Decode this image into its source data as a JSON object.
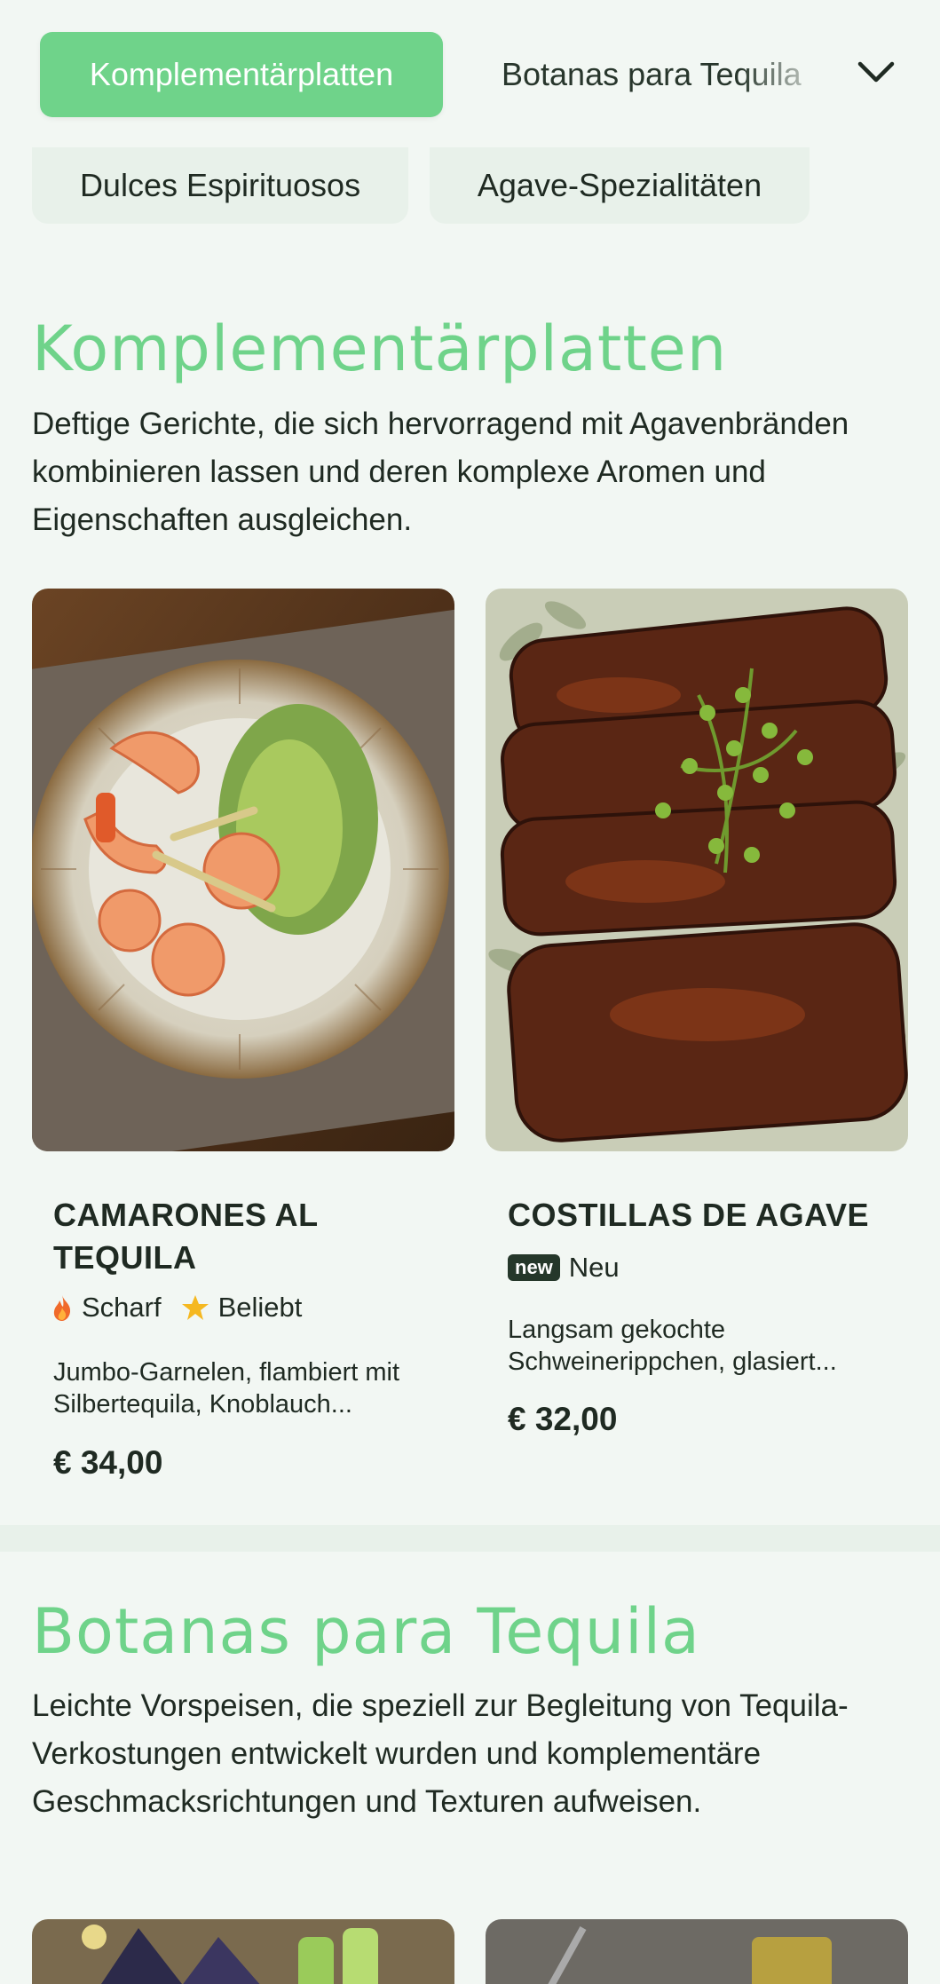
{
  "nav": {
    "active": "Komplementärplatten",
    "next": "Botanas para Tequila",
    "row2": [
      "Dulces Espirituosos",
      "Agave-Spezialitäten"
    ],
    "toggle_icon": "chevron-down-icon"
  },
  "sections": [
    {
      "title": "Komplementärplatten",
      "description": "Deftige Gerichte, die sich hervorragend mit Agavenbränden kombinieren lassen und deren komplexe Aromen und Eigenschaften ausgleichen.",
      "items": [
        {
          "name": "CAMARONES AL TEQUILA",
          "tags": [
            {
              "icon": "fire-icon",
              "label": "Scharf"
            },
            {
              "icon": "star-icon",
              "label": "Beliebt"
            }
          ],
          "description": "Jumbo-Garnelen, flambiert mit Silbertequila, Knoblauch...",
          "price": "€ 34,00",
          "image": "shrimp-plate-photo"
        },
        {
          "name": "COSTILLAS DE AGAVE",
          "badge": "new",
          "badge_label": "Neu",
          "description": "Langsam gekochte Schweinerippchen, glasiert...",
          "price": "€ 32,00",
          "image": "glazed-ribs-photo"
        }
      ]
    },
    {
      "title": "Botanas para Tequila",
      "description": "Leichte Vorspeisen, die speziell zur Begleitung von Tequila-Verkostungen entwickelt wurden und komplementäre Geschmacksrichtungen und Texturen aufweisen."
    }
  ],
  "colors": {
    "accent": "#6fd38a",
    "background": "#f2f7f3",
    "text": "#1f2a22"
  }
}
